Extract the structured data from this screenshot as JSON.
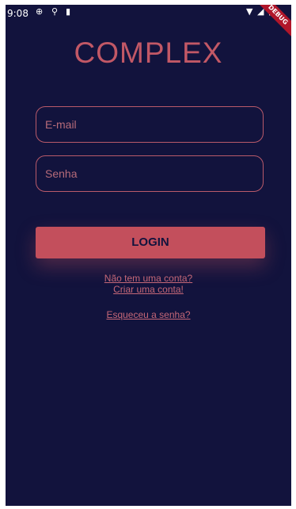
{
  "status_bar": {
    "time": "9:08",
    "debug_label": "DEBUG"
  },
  "app": {
    "title": "COMPLEX"
  },
  "form": {
    "email_placeholder": "E-mail",
    "password_placeholder": "Senha",
    "login_label": "LOGIN"
  },
  "links": {
    "no_account": "Não tem uma conta?",
    "create_account": "Criar uma conta!",
    "forgot_password": "Esqueceu a senha?"
  },
  "colors": {
    "background": "#12133d",
    "accent": "#c34f5c"
  }
}
